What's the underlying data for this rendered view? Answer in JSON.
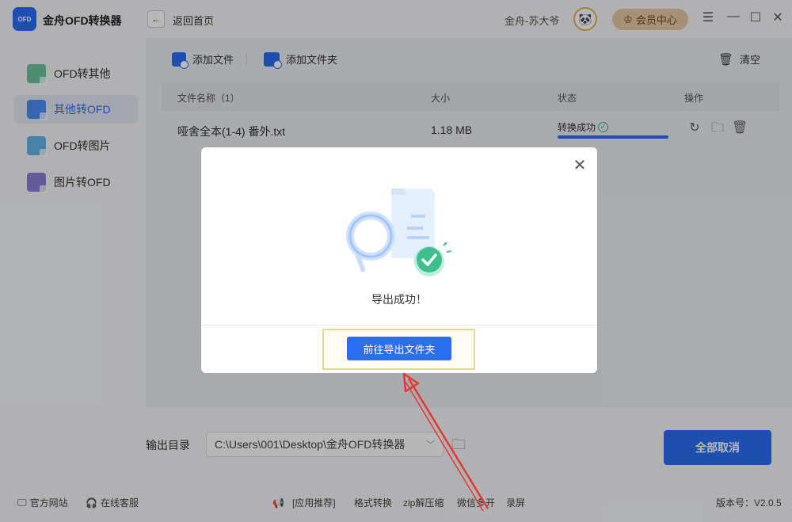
{
  "app": {
    "logo_text": "OFD",
    "title": "金舟OFD转换器"
  },
  "header": {
    "back_label": "返回首页",
    "user_name": "金舟-苏大爷",
    "vip_label": "会员中心"
  },
  "sidebar": {
    "items": [
      {
        "label": "OFD转其他",
        "active": false
      },
      {
        "label": "其他转OFD",
        "active": true
      },
      {
        "label": "OFD转图片",
        "active": false
      },
      {
        "label": "图片转OFD",
        "active": false
      }
    ]
  },
  "toolbar": {
    "add_file": "添加文件",
    "add_folder": "添加文件夹",
    "clear": "清空"
  },
  "table": {
    "headers": [
      "文件名称（1）",
      "大小",
      "状态",
      "操作"
    ],
    "rows": [
      {
        "name": "哑舍全本(1-4) 番外.txt",
        "size": "1.18 MB",
        "status": "转换成功",
        "progress": 1.0
      }
    ]
  },
  "output": {
    "label": "输出目录",
    "path": "C:\\Users\\001\\Desktop\\金舟OFD转换器",
    "cancel_all": "全部取消"
  },
  "footer": {
    "website": "官方网站",
    "support": "在线客服",
    "recommend": "[应用推荐]",
    "format": "格式转换",
    "zip": "zip解压缩",
    "wechat": "微信多开",
    "record": "录屏",
    "version": "版本号：V2.0.5"
  },
  "modal": {
    "message": "导出成功！",
    "button": "前往导出文件夹"
  },
  "colors": {
    "accent": "#2b6ef2",
    "success": "#38b27a",
    "arrow": "#e53935",
    "vip": "#e8c9a4"
  },
  "icons": {
    "back": "arrow-left-icon",
    "clear": "trash-icon",
    "refresh": "refresh-icon",
    "folder": "folder-icon",
    "delete": "trash-icon",
    "close": "close-icon",
    "website": "monitor-icon",
    "support": "headset-icon",
    "recommend": "megaphone-icon"
  }
}
